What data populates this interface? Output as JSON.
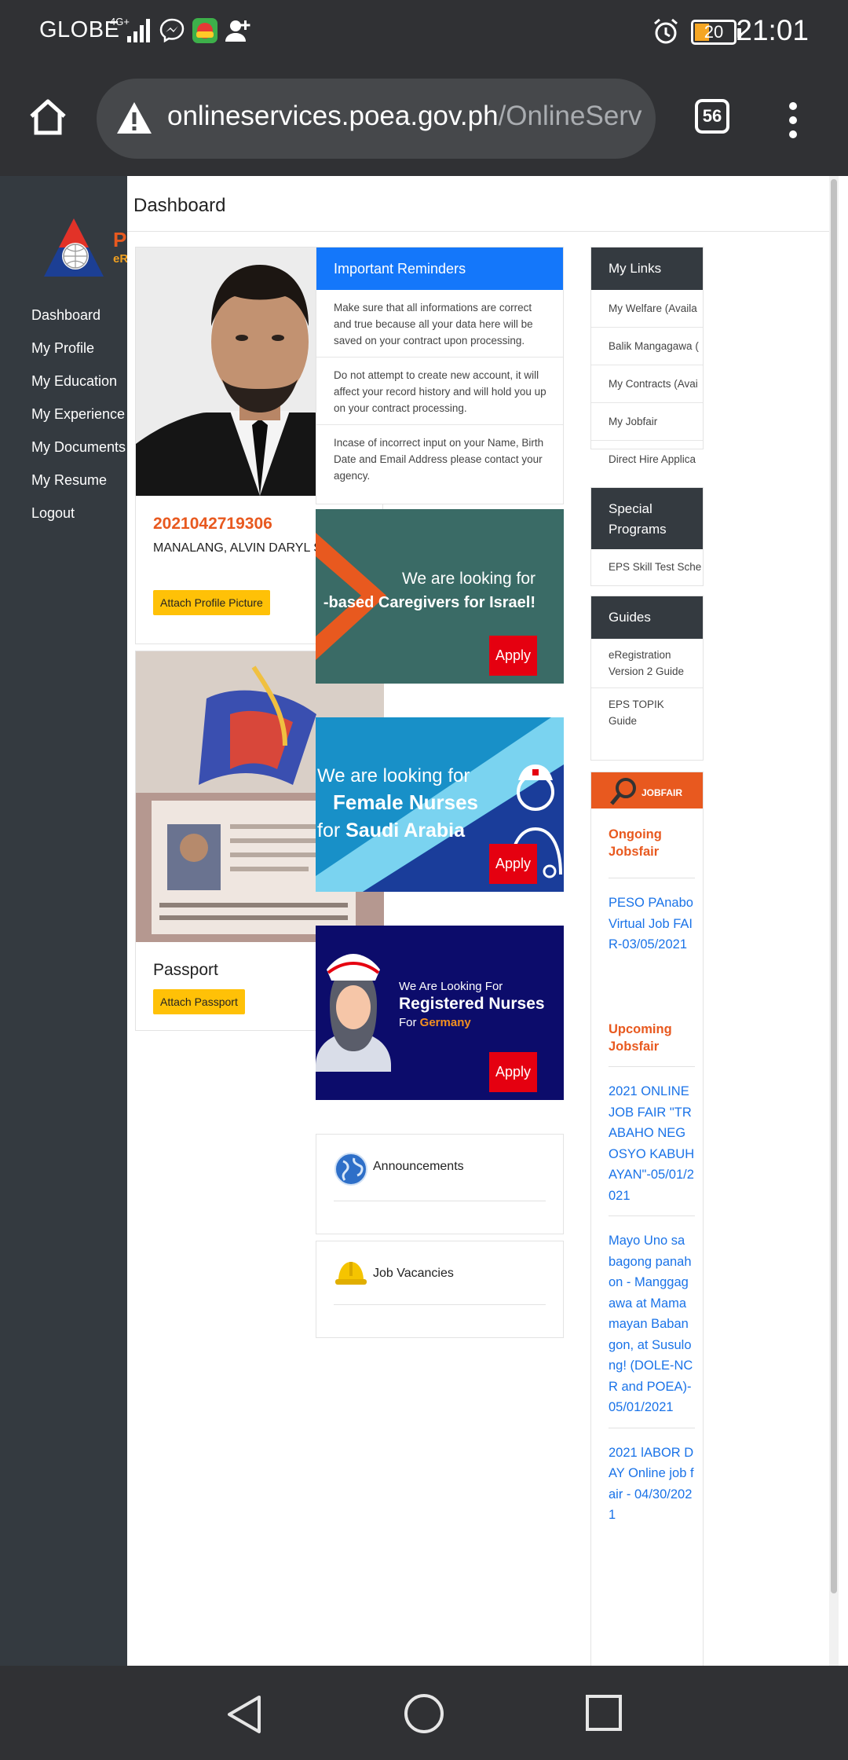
{
  "status_bar": {
    "carrier": "GLOBE",
    "network": "4G+",
    "battery": "20",
    "time": "21:01"
  },
  "browser": {
    "url_domain": "onlineservices.poea.gov.ph",
    "url_path": "/OnlineServ",
    "tab_count": "56"
  },
  "sidebar": {
    "items": [
      {
        "label": "Dashboard"
      },
      {
        "label": "My Profile"
      },
      {
        "label": "My Education"
      },
      {
        "label": "My Experience"
      },
      {
        "label": "My Documents"
      },
      {
        "label": "My Resume"
      },
      {
        "label": "Logout"
      }
    ]
  },
  "page": {
    "title": "Dashboard"
  },
  "profile": {
    "ref_no": "2021042719306",
    "name": "MANALANG, ALVIN DARYL SAWAY",
    "attach_picture_label": "Attach Profile Picture",
    "passport_label": "Passport",
    "attach_passport_label": "Attach Passport"
  },
  "reminders": {
    "title": "Important Reminders",
    "items": [
      "Make sure that all informations are correct and true because all your data here will be saved on your contract upon processing.",
      "Do not attempt to create new account, it will affect your record history and will hold you up on your contract processing.",
      "Incase of incorrect input on your Name, Birth Date and Email Address please contact your agency."
    ]
  },
  "banners": [
    {
      "line1": "We are looking for",
      "line2": "-based Caregivers for Israel!",
      "apply": "Apply",
      "bg": "#3a6b66"
    },
    {
      "line1": "We are looking for",
      "line2a": "Female Nurses",
      "line3a": "for ",
      "line3b": "Saudi Arabia",
      "apply": "Apply",
      "bg": "#1890c8"
    },
    {
      "line1": "We Are Looking For",
      "line2": "Registered Nurses",
      "line3a": "For ",
      "line3b": "Germany",
      "apply": "Apply",
      "bg": "#0c0c6b"
    }
  ],
  "info_cards": {
    "announcements": "Announcements",
    "job_vacancies": "Job Vacancies"
  },
  "right_column": {
    "my_links_title": "My Links",
    "my_links": [
      "My Welfare (Availa",
      "Balik Mangagawa (",
      "My Contracts (Avai",
      "My Jobfair",
      "Direct Hire Applica"
    ],
    "special_programs_title": "Special Programs",
    "special_programs": [
      "EPS Skill Test Sche"
    ],
    "guides_title": "Guides",
    "guides": [
      "eRegistration Version 2 Guide",
      "EPS TOPIK Guide"
    ],
    "jobfair_logo_text": "JOBFAIR",
    "ongoing_title": "Ongoing Jobsfair",
    "ongoing": [
      "PESO PAnabo Virtual Job FAIR-03/05/2021"
    ],
    "upcoming_title": "Upcoming Jobsfair",
    "upcoming": [
      "2021 ONLINE JOB FAIR \"TRABAHO NEGOSYO KABUHAYAN\"-05/01/2021",
      "Mayo Uno sa bagong panahon - Manggagawa at Mamamayan Babangon, at Susulong! (DOLE-NCR and POEA)-05/01/2021",
      "2021 lABOR DAY Online job fair - 04/30/2021"
    ]
  },
  "colors": {
    "accent_blue": "#1477fa",
    "orange": "#e8591f",
    "sidebar": "#343a40",
    "apply_red": "#e50010",
    "button_yellow": "#ffc107"
  }
}
